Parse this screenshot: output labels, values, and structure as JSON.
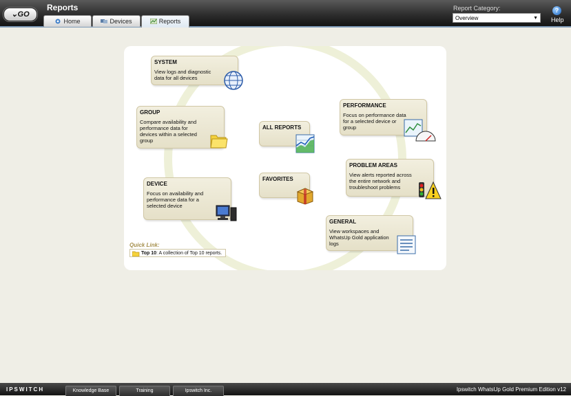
{
  "header": {
    "go_label": "GO",
    "title": "Reports",
    "tabs": [
      {
        "label": "Home"
      },
      {
        "label": "Devices"
      },
      {
        "label": "Reports"
      }
    ],
    "report_category": {
      "label": "Report Category:",
      "value": "Overview"
    },
    "help_label": "Help",
    "help_symbol": "?"
  },
  "cards": {
    "system": {
      "title": "SYSTEM",
      "desc1": "View logs and diagnostic",
      "desc2": "data for all devices",
      "icon": "globe-icon"
    },
    "group": {
      "title": "GROUP",
      "desc1": "Compare availability and",
      "desc2": "performance data for",
      "desc3": "devices within a selected",
      "desc4": "group",
      "icon": "folder-icon"
    },
    "device": {
      "title": "DEVICE",
      "desc1": "Focus on availability and",
      "desc2": "performance data for a",
      "desc3": "selected device",
      "icon": "computer-icon"
    },
    "all_reports": {
      "title": "ALL REPORTS",
      "icon": "chart-icon"
    },
    "favorites": {
      "title": "FAVORITES",
      "icon": "box-icon"
    },
    "performance": {
      "title": "PERFORMANCE",
      "desc1": "Focus on performance data",
      "desc2": "for a selected device or",
      "desc3": "group",
      "icon": "gauge-icon"
    },
    "problem_areas": {
      "title": "PROBLEM AREAS",
      "desc1": "View alerts reported across",
      "desc2": "the entire network and",
      "desc3": "troubleshoot problems",
      "icon": "warning-icon"
    },
    "general": {
      "title": "GENERAL",
      "desc1": "View workspaces and",
      "desc2": "WhatsUp Gold application",
      "desc3": "logs",
      "icon": "document-icon"
    }
  },
  "quick_link": {
    "label": "Quick Link:",
    "name": "Top 10",
    "desc": ": A collection of Top 10 reports."
  },
  "footer": {
    "logo": "IPSWITCH",
    "links": [
      "Knowledge Base",
      "Training",
      "Ipswitch Inc."
    ],
    "edition": "Ipswitch WhatsUp Gold Premium Edition   v12"
  },
  "colors": {
    "header_bg": "#2e2e2e",
    "page_bg": "#efeee6",
    "card_bg": "#ebe6d2",
    "quick_link": "#a58f4c"
  }
}
